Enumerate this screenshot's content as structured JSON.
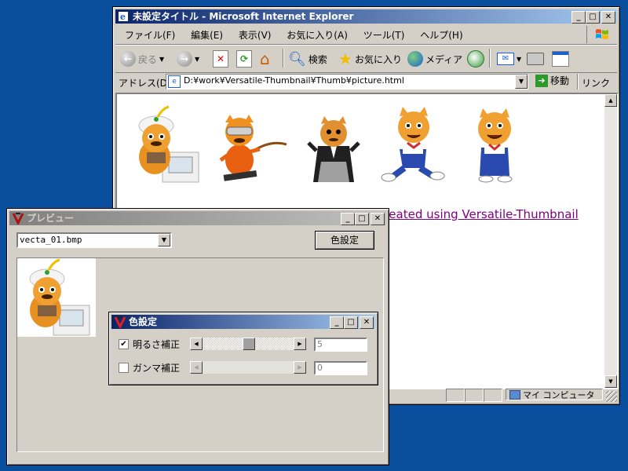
{
  "ie": {
    "title": "未設定タイトル - Microsoft Internet Explorer",
    "menu": [
      "ファイル(F)",
      "編集(E)",
      "表示(V)",
      "お気に入り(A)",
      "ツール(T)",
      "ヘルプ(H)"
    ],
    "toolbar": {
      "back": "戻る",
      "search": "検索",
      "favorites": "お気に入り",
      "media": "メディア"
    },
    "address_label": "アドレス(D)",
    "address_value": "D:¥work¥Versatile-Thumbnail¥Thumb¥picture.html",
    "go": "移動",
    "links": "リンク",
    "page_link": "Created using Versatile-Thumbnail",
    "status_zone": "マイ コンピュータ"
  },
  "preview": {
    "title": "プレビュー",
    "file_select": "vecta_01.bmp",
    "color_button": "色設定"
  },
  "color_dialog": {
    "title": "色設定",
    "brightness_label": "明るさ補正",
    "brightness_checked": true,
    "brightness_value": "5",
    "brightness_level": 0.5,
    "gamma_label": "ガンマ補正",
    "gamma_checked": false,
    "gamma_value": "0"
  },
  "colors": {
    "desktop": "#0a4f9e",
    "face": "#d4d0c8",
    "title_active": "#0a246a",
    "link": "#800080"
  }
}
